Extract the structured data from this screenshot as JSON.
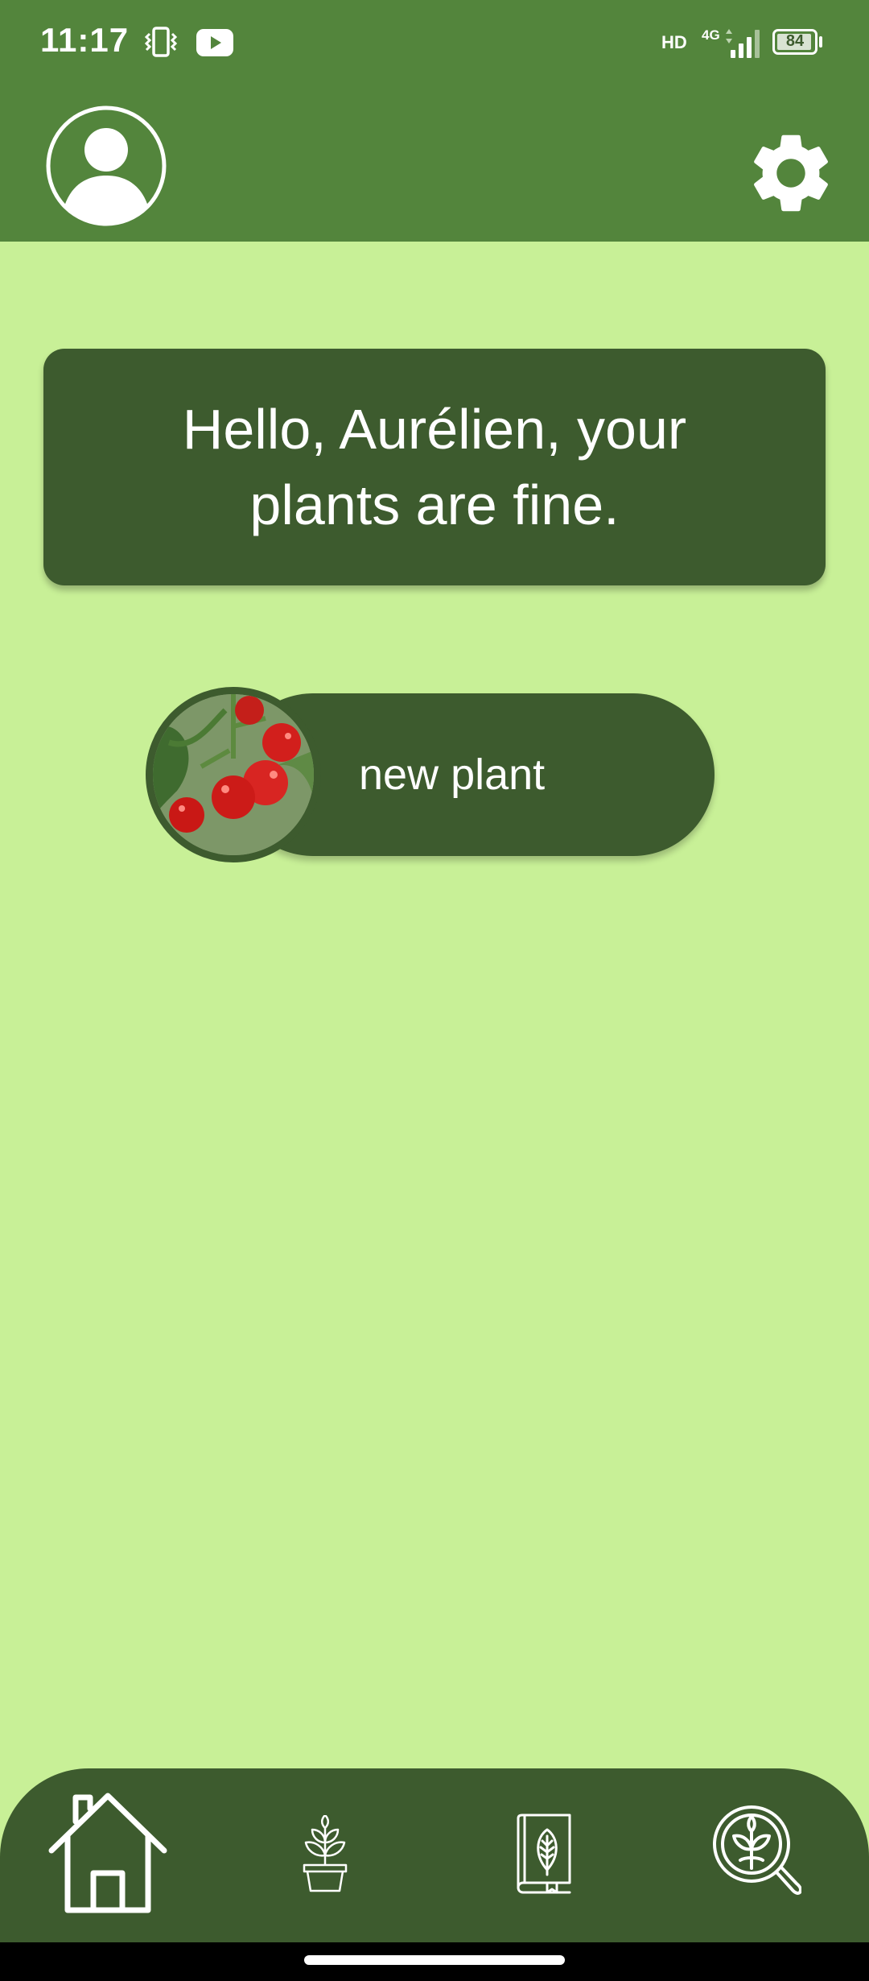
{
  "status_bar": {
    "time": "11:17",
    "hd": "HD",
    "network": "4G",
    "battery": "84",
    "battery_level": 0.84,
    "icons": [
      "vibrate-icon",
      "youtube-icon",
      "signal-icon",
      "battery-icon"
    ]
  },
  "app_bar": {
    "icons": [
      "account-icon",
      "settings-gear-icon"
    ]
  },
  "greeting": {
    "text": "Hello, Aurélien, your plants are fine."
  },
  "plants": [
    {
      "name": "new plant",
      "image": "tomato-plant-photo"
    }
  ],
  "bottom_nav": {
    "items": [
      {
        "icon": "home-icon",
        "active": true
      },
      {
        "icon": "potted-plant-icon",
        "active": false
      },
      {
        "icon": "plant-book-icon",
        "active": false
      },
      {
        "icon": "plant-search-icon",
        "active": false
      }
    ]
  },
  "colors": {
    "app_bar": "#53853c",
    "background": "#c8f097",
    "card": "#3d5b2e",
    "text": "#ffffff"
  }
}
